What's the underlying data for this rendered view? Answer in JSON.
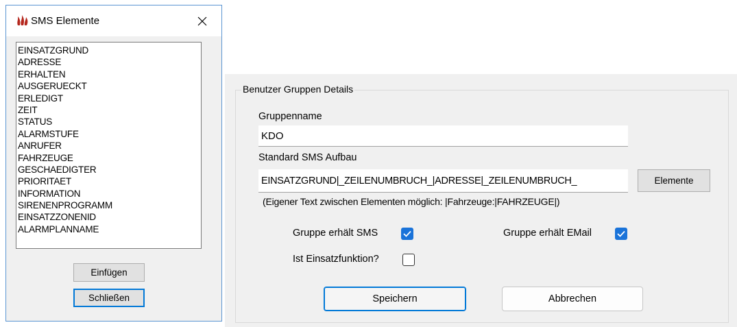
{
  "dialog": {
    "title": "SMS Elemente",
    "icon": "flame-icon",
    "close_icon": "close-icon",
    "list_items": [
      "EINSATZGRUND",
      "ADRESSE",
      "ERHALTEN",
      "AUSGERUECKT",
      "ERLEDIGT",
      "ZEIT",
      "STATUS",
      "ALARMSTUFE",
      "ANRUFER",
      "FAHRZEUGE",
      "GESCHAEDIGTER",
      "PRIORITAET",
      "INFORMATION",
      "SIRENENPROGRAMM",
      "EINSATZZONENID",
      "ALARMPLANNAME"
    ],
    "insert_label": "Einfügen",
    "close_label": "Schließen"
  },
  "details": {
    "group_title": "Benutzer Gruppen Details",
    "groupname_label": "Gruppenname",
    "groupname_value": "KDO",
    "sms_format_label": "Standard SMS Aufbau",
    "sms_format_value": "EINSATZGRUND|_ZEILENUMBRUCH_|ADRESSE|_ZEILENUMBRUCH_",
    "elements_button": "Elemente",
    "hint": "(Eigener Text zwischen Elementen möglich: |Fahrzeuge:|FAHRZEUGE|)",
    "gets_sms_label": "Gruppe erhält SMS",
    "gets_sms_checked": true,
    "gets_email_label": "Gruppe erhält EMail",
    "gets_email_checked": true,
    "is_function_label": "Ist Einsatzfunktion?",
    "is_function_checked": false,
    "save_label": "Speichern",
    "cancel_label": "Abbrechen"
  },
  "colors": {
    "accent": "#0078d7",
    "checkbox_checked": "#1a73d9",
    "dialog_border": "#5b95d2",
    "panel_bg": "#f0f0f0",
    "icon_color": "#b5281e"
  }
}
